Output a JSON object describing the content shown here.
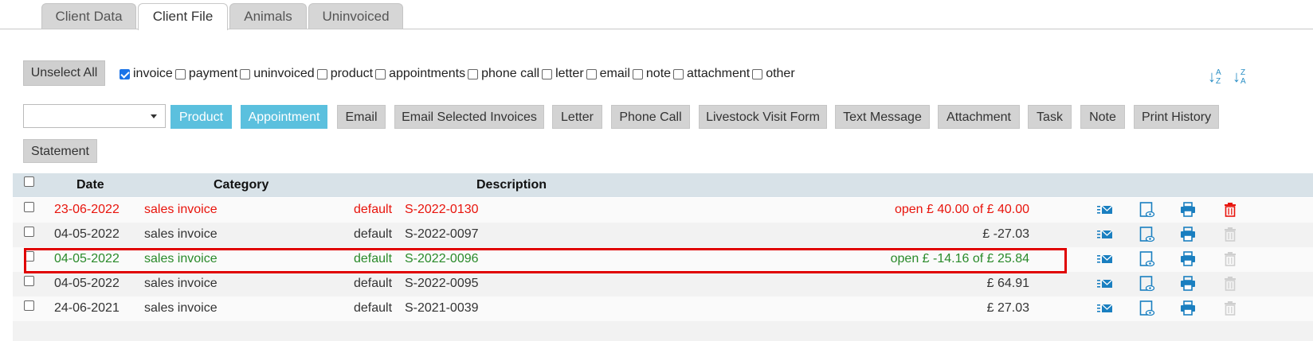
{
  "tabs": [
    {
      "label": "Client Data",
      "active": false
    },
    {
      "label": "Client File",
      "active": true
    },
    {
      "label": "Animals",
      "active": false
    },
    {
      "label": "Uninvoiced",
      "active": false
    }
  ],
  "filters": {
    "unselect_all": "Unselect All",
    "items": [
      {
        "label": "invoice",
        "checked": true
      },
      {
        "label": "payment",
        "checked": false
      },
      {
        "label": "uninvoiced",
        "checked": false
      },
      {
        "label": "product",
        "checked": false
      },
      {
        "label": "appointments",
        "checked": false
      },
      {
        "label": "phone call",
        "checked": false
      },
      {
        "label": "letter",
        "checked": false
      },
      {
        "label": "email",
        "checked": false
      },
      {
        "label": "note",
        "checked": false
      },
      {
        "label": "attachment",
        "checked": false
      },
      {
        "label": "other",
        "checked": false
      }
    ],
    "sort_az_icon": "sort-alpha-asc-icon",
    "sort_za_icon": "sort-alpha-desc-icon"
  },
  "toolbar": {
    "select_value": "",
    "buttons": [
      {
        "label": "Product",
        "style": "blue"
      },
      {
        "label": "Appointment",
        "style": "blue"
      },
      {
        "label": "Email",
        "style": "grey"
      },
      {
        "label": "Email Selected Invoices",
        "style": "grey"
      },
      {
        "label": "Letter",
        "style": "grey"
      },
      {
        "label": "Phone Call",
        "style": "grey"
      },
      {
        "label": "Livestock Visit Form",
        "style": "grey"
      },
      {
        "label": "Text Message",
        "style": "grey"
      },
      {
        "label": "Attachment",
        "style": "grey"
      },
      {
        "label": "Task",
        "style": "grey"
      },
      {
        "label": "Note",
        "style": "grey"
      },
      {
        "label": "Print History",
        "style": "grey"
      },
      {
        "label": "Statement",
        "style": "grey"
      }
    ]
  },
  "table": {
    "headers": {
      "date": "Date",
      "category": "Category",
      "description": "Description"
    },
    "rows": [
      {
        "date": "23-06-2022",
        "category": "sales invoice",
        "type": "default",
        "number": "S-2022-0130",
        "amount": "open £ 40.00 of £ 40.00",
        "color": "red",
        "delete_active": true
      },
      {
        "date": "04-05-2022",
        "category": "sales invoice",
        "type": "default",
        "number": "S-2022-0097",
        "amount": "£ -27.03",
        "color": "dark",
        "delete_active": false
      },
      {
        "date": "04-05-2022",
        "category": "sales invoice",
        "type": "default",
        "number": "S-2022-0096",
        "amount": "open £ -14.16 of £ 25.84",
        "color": "green",
        "delete_active": false
      },
      {
        "date": "04-05-2022",
        "category": "sales invoice",
        "type": "default",
        "number": "S-2022-0095",
        "amount": "£ 64.91",
        "color": "dark",
        "delete_active": false
      },
      {
        "date": "24-06-2021",
        "category": "sales invoice",
        "type": "default",
        "number": "S-2021-0039",
        "amount": "£ 27.03",
        "color": "dark",
        "delete_active": false
      }
    ],
    "row_icons": [
      "email-list-icon",
      "preview-document-icon",
      "print-icon",
      "trash-icon"
    ]
  },
  "colors": {
    "accent_blue": "#5bc0de",
    "icon_blue": "#1a7fc0",
    "overdue_red": "#e8140c",
    "paid_green": "#2a8a2a",
    "highlight_red": "#e00000"
  }
}
